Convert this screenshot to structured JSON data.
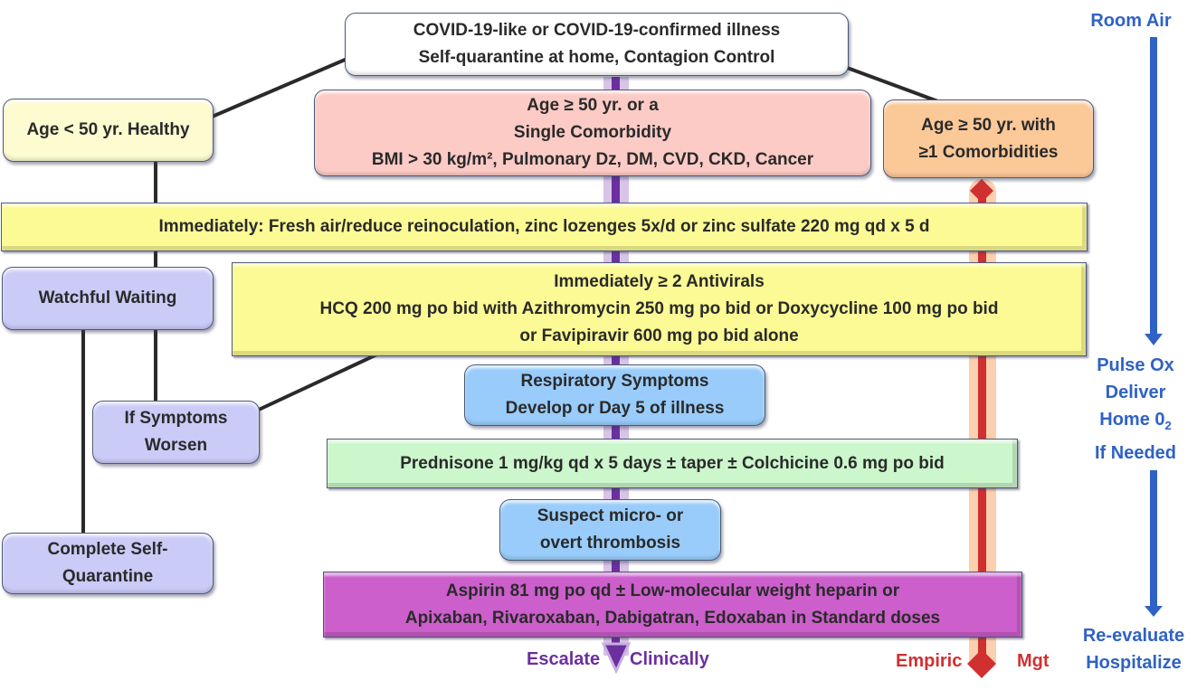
{
  "colors": {
    "escalate_track": "#6b2fa0",
    "empiric_track": "#d03030",
    "oxygen_track": "#2f62c4",
    "connector": "#2a2a2a"
  },
  "nodes": {
    "start": {
      "line1": "COVID-19-like or COVID-19-confirmed illness",
      "line2": "Self-quarantine at home, Contagion Control"
    },
    "young_healthy": {
      "line1": "Age < 50 yr. Healthy"
    },
    "single_comorbidity": {
      "line1": "Age ≥ 50 yr. or a",
      "line2": "Single Comorbidity",
      "line3": "BMI > 30 kg/m², Pulmonary Dz, DM, CVD, CKD, Cancer"
    },
    "multi_comorbidity": {
      "line1": "Age ≥ 50 yr. with",
      "line2": "≥1 Comorbidities"
    },
    "immediate_zinc": {
      "line1": "Immediately:  Fresh air/reduce reinoculation, zinc lozenges 5x/d or zinc sulfate 220 mg qd x 5 d"
    },
    "watchful_waiting": {
      "line1": "Watchful Waiting"
    },
    "antivirals": {
      "line1": "Immediately ≥ 2 Antivirals",
      "line2": "HCQ 200 mg po bid with Azithromycin 250 mg po bid or Doxycycline 100 mg po bid",
      "line3": "or Favipiravir 600 mg po bid alone"
    },
    "symptoms_worsen": {
      "line1": "If Symptoms",
      "line2": "Worsen"
    },
    "respiratory": {
      "line1": "Respiratory Symptoms",
      "line2": "Develop or Day 5 of illness"
    },
    "prednisone": {
      "line1": "Prednisone 1 mg/kg qd x 5 days ± taper ± Colchicine 0.6 mg po bid"
    },
    "thrombosis": {
      "line1": "Suspect micro- or",
      "line2": "overt thrombosis"
    },
    "complete_quarantine": {
      "line1": "Complete Self-",
      "line2": "Quarantine"
    },
    "anticoagulation": {
      "line1": "Aspirin 81 mg po qd ± Low-molecular weight heparin or",
      "line2": "Apixaban, Rivaroxaban, Dabigatran, Edoxaban in Standard doses"
    }
  },
  "tracks": {
    "escalate_left": "Escalate",
    "escalate_right": "Clinically",
    "empiric_left": "Empiric",
    "empiric_right": "Mgt"
  },
  "oxygen": {
    "top": "Room Air",
    "middle": [
      "Pulse Ox",
      "Deliver",
      "Home 0",
      "If Needed"
    ],
    "middle_sub": "2",
    "bottom": [
      "Re-evaluate",
      "Hospitalize"
    ]
  }
}
